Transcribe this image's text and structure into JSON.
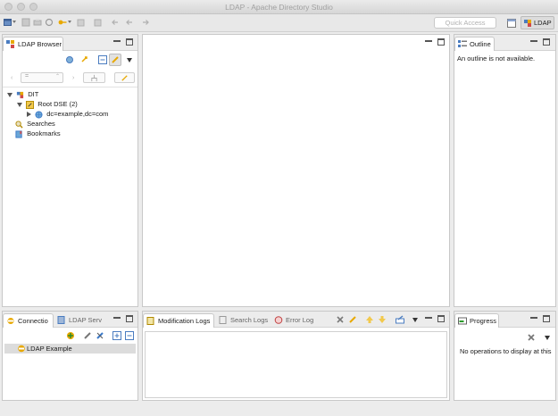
{
  "window": {
    "title": "LDAP - Apache Directory Studio"
  },
  "toolbar": {
    "quick_access_placeholder": "Quick Access",
    "perspective_label": "LDAP"
  },
  "ldap_browser": {
    "tab_label": "LDAP Browser",
    "filter_value": "",
    "tree": [
      {
        "label": "DIT",
        "icon": "dit-icon"
      },
      {
        "label": "Root DSE (2)",
        "icon": "root-dse-icon"
      },
      {
        "label": "dc=example,dc=com",
        "icon": "globe-icon"
      },
      {
        "label": "Searches",
        "icon": "searches-icon"
      },
      {
        "label": "Bookmarks",
        "icon": "bookmarks-icon"
      }
    ]
  },
  "outline": {
    "tab_label": "Outline",
    "message": "An outline is not available."
  },
  "connections": {
    "tabs": [
      "Connectio",
      "LDAP Serv"
    ],
    "items": [
      {
        "label": "LDAP Example"
      }
    ]
  },
  "logs": {
    "tabs": [
      "Modification Logs",
      "Search Logs",
      "Error Log"
    ]
  },
  "progress": {
    "tab_label": "Progress",
    "message": "No operations to display at this"
  },
  "colors": {
    "accent": "#e8a800",
    "selection": "#dcdcdc",
    "link_blue": "#3a78c8"
  }
}
